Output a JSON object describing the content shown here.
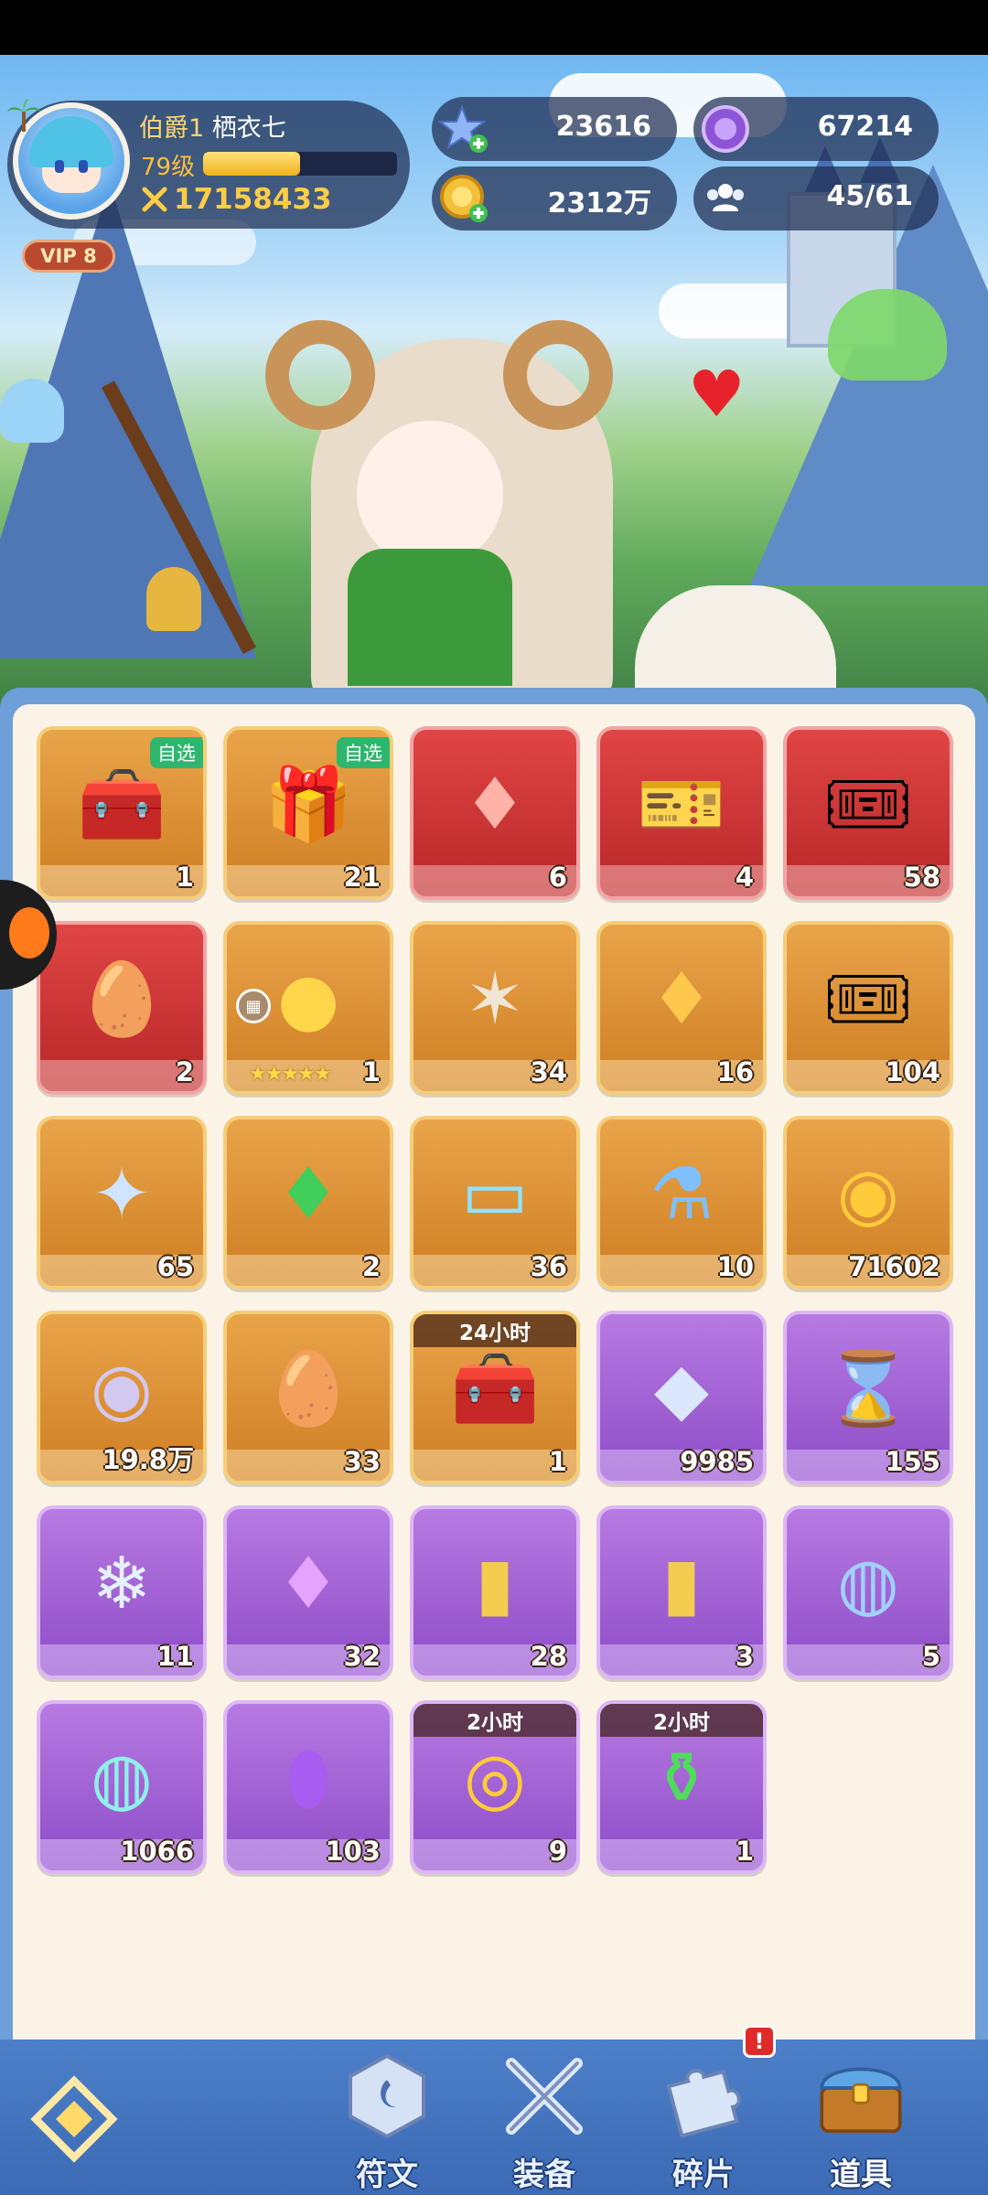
{
  "player": {
    "rank": "伯爵1",
    "name": "栖衣七",
    "level": "79级",
    "exp_progress": 0.5,
    "power": "17158433",
    "vip": "VIP 8"
  },
  "currencies": [
    {
      "id": "star-gem",
      "icon": "star-plus-icon",
      "value": "23616"
    },
    {
      "id": "purple-coin",
      "icon": "purple-coin-icon",
      "value": "67214"
    },
    {
      "id": "gold-coin",
      "icon": "gold-coin-plus-icon",
      "value": "2312万"
    },
    {
      "id": "party",
      "icon": "people-icon",
      "value": "45/61"
    }
  ],
  "inventory": [
    {
      "icon": "flower-chest-icon",
      "rarity": "gold",
      "count": "1",
      "tag": "自选"
    },
    {
      "icon": "gift-chest-icon",
      "rarity": "gold",
      "count": "21",
      "tag": "自选"
    },
    {
      "icon": "red-crystal-icon",
      "rarity": "red",
      "count": "6"
    },
    {
      "icon": "blue-ticket-icon",
      "rarity": "red",
      "count": "4"
    },
    {
      "icon": "sun-ticket-icon",
      "rarity": "red",
      "count": "58"
    },
    {
      "icon": "flame-egg-icon",
      "rarity": "red",
      "count": "2"
    },
    {
      "icon": "golden-orb-icon",
      "rarity": "gold",
      "count": "1",
      "stars": "★★★★★"
    },
    {
      "icon": "coral-branch-icon",
      "rarity": "gold",
      "count": "34"
    },
    {
      "icon": "amber-crystal-icon",
      "rarity": "gold",
      "count": "16"
    },
    {
      "icon": "gold-ticket-icon",
      "rarity": "gold",
      "count": "104"
    },
    {
      "icon": "blue-star-icon",
      "rarity": "gold",
      "count": "65"
    },
    {
      "icon": "green-gem-icon",
      "rarity": "gold",
      "count": "2"
    },
    {
      "icon": "heart-card-icon",
      "rarity": "gold",
      "count": "36"
    },
    {
      "icon": "lightning-potion-icon",
      "rarity": "gold",
      "count": "10"
    },
    {
      "icon": "gold-medal-icon",
      "rarity": "gold",
      "count": "71602"
    },
    {
      "icon": "silver-medal-icon",
      "rarity": "gold",
      "count": "19.8万"
    },
    {
      "icon": "dragon-egg-icon",
      "rarity": "gold",
      "count": "33"
    },
    {
      "icon": "treasure-chest-icon",
      "rarity": "gold",
      "count": "1",
      "timer": "24小时"
    },
    {
      "icon": "diamond-icon",
      "rarity": "purple",
      "count": "9985"
    },
    {
      "icon": "hourglass-icon",
      "rarity": "purple",
      "count": "155"
    },
    {
      "icon": "ice-crystal-icon",
      "rarity": "purple",
      "count": "11"
    },
    {
      "icon": "purple-crystal-icon",
      "rarity": "purple",
      "count": "32"
    },
    {
      "icon": "sword-card-icon",
      "rarity": "purple",
      "count": "28"
    },
    {
      "icon": "refresh-card-icon",
      "rarity": "purple",
      "count": "3"
    },
    {
      "icon": "blue-orb-icon",
      "rarity": "purple",
      "count": "5"
    },
    {
      "icon": "cyan-orb-icon",
      "rarity": "purple",
      "count": "1066"
    },
    {
      "icon": "purple-egg-icon",
      "rarity": "purple",
      "count": "103"
    },
    {
      "icon": "coin-stack-icon",
      "rarity": "purple",
      "count": "9",
      "timer": "2小时"
    },
    {
      "icon": "green-potion-icon",
      "rarity": "purple",
      "count": "1",
      "timer": "2小时"
    }
  ],
  "nav": {
    "items": [
      {
        "label": "符文",
        "icon": "rune-icon"
      },
      {
        "label": "装备",
        "icon": "crossed-swords-icon"
      },
      {
        "label": "碎片",
        "icon": "puzzle-piece-icon",
        "alert": "!"
      },
      {
        "label": "道具",
        "icon": "treasure-chest-icon",
        "active": true
      }
    ]
  }
}
